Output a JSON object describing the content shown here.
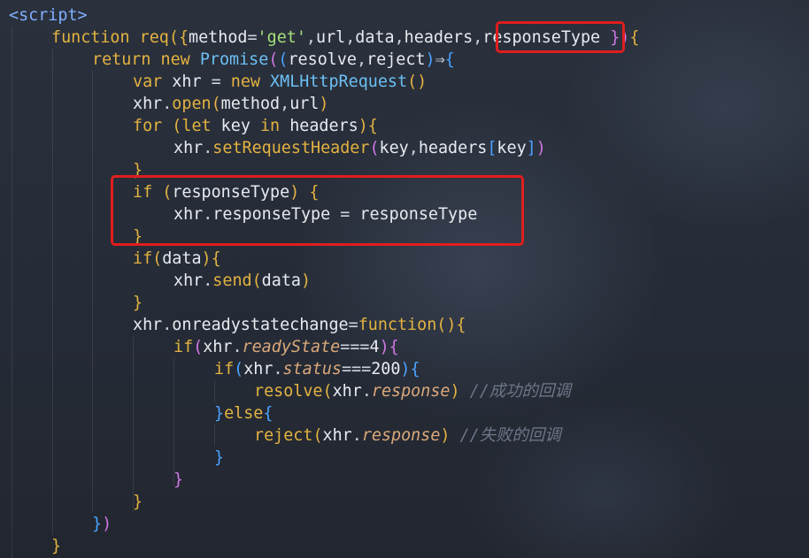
{
  "code": {
    "language": "html/javascript",
    "lines": [
      "<script>",
      "function req({method='get',url,data,headers,responseType }){",
      "return new Promise((resolve,reject)⇒{",
      "var xhr = new XMLHttpRequest()",
      "xhr.open(method,url)",
      "for (let key in headers){",
      "xhr.setRequestHeader(key,headers[key])",
      "}",
      "if (responseType) {",
      "xhr.responseType = responseType",
      "}",
      "if(data){",
      "xhr.send(data)",
      "}",
      "xhr.onreadystatechange=function(){",
      "if(xhr.readyState===4){",
      "if(xhr.status===200){",
      "resolve(xhr.response) //成功的回调",
      "}else{",
      "reject(xhr.response) //失败的回调",
      "}",
      "}",
      "}",
      "})",
      "}"
    ]
  },
  "tokens": {
    "l0": {
      "lt": "<",
      "tag": "script",
      "gt": ">"
    },
    "l1": {
      "kw": "function",
      "name": "req",
      "p1": "({",
      "a": "method",
      "eq": "=",
      "s": "'get'",
      "c1": ",",
      "b": "url",
      "c2": ",",
      "c": "data",
      "c3": ",",
      "d": "headers",
      "c4": ",",
      "e": "responseType",
      "sp": " ",
      "close": "})",
      "brace": "{"
    },
    "l2": {
      "kw1": "return",
      "kw2": "new",
      "cls": "Promise",
      "o1": "(",
      "o2": "(",
      "a": "resolve",
      "c": ",",
      "b": "reject",
      "o3": ")",
      "arrow": "⇒",
      "brace": "{"
    },
    "l3": {
      "kw1": "var",
      "id": "xhr",
      "eq": "=",
      "kw2": "new",
      "cls": "XMLHttpRequest",
      "p": "()"
    },
    "l4": {
      "o": "xhr",
      "dot": ".",
      "m": "open",
      "p1": "(",
      "a": "method",
      "c": ",",
      "b": "url",
      "p2": ")"
    },
    "l5": {
      "kw": "for",
      "p1": "(",
      "kw2": "let",
      "a": "key",
      "kw3": "in",
      "b": "headers",
      "p2": ")",
      "brace": "{"
    },
    "l6": {
      "o": "xhr",
      "dot": ".",
      "m": "setRequestHeader",
      "p1": "(",
      "a": "key",
      "c": ",",
      "b": "headers",
      "bk1": "[",
      "k": "key",
      "bk2": "]",
      "p2": ")"
    },
    "l7": {
      "brace": "}"
    },
    "l8": {
      "kw": "if",
      "p1": "(",
      "a": "responseType",
      "p2": ")",
      "brace": "{"
    },
    "l9": {
      "o": "xhr",
      "dot": ".",
      "prop": "responseType",
      "eq": "=",
      "v": "responseType"
    },
    "l10": {
      "brace": "}"
    },
    "l11": {
      "kw": "if",
      "p1": "(",
      "a": "data",
      "p2": ")",
      "brace": "{"
    },
    "l12": {
      "o": "xhr",
      "dot": ".",
      "m": "send",
      "p1": "(",
      "a": "data",
      "p2": ")"
    },
    "l13": {
      "brace": "}"
    },
    "l14": {
      "o": "xhr",
      "dot": ".",
      "prop": "onreadystatechange",
      "eq": "=",
      "kw": "function",
      "p": "()",
      "brace": "{"
    },
    "l15": {
      "kw": "if",
      "p1": "(",
      "o": "xhr",
      "dot": ".",
      "prop": "readyState",
      "op": "===",
      "n": "4",
      "p2": ")",
      "brace": "{"
    },
    "l16": {
      "kw": "if",
      "p1": "(",
      "o": "xhr",
      "dot": ".",
      "prop": "status",
      "op": "===",
      "n": "200",
      "p2": ")",
      "brace": "{"
    },
    "l17": {
      "fn": "resolve",
      "p1": "(",
      "o": "xhr",
      "dot": ".",
      "prop": "response",
      "p2": ")",
      "cm": "//成功的回调"
    },
    "l18": {
      "b1": "}",
      "kw": "else",
      "b2": "{"
    },
    "l19": {
      "fn": "reject",
      "p1": "(",
      "o": "xhr",
      "dot": ".",
      "prop": "response",
      "p2": ")",
      "cm": "//失败的回调"
    },
    "l20": {
      "brace": "}"
    },
    "l21": {
      "brace": "}"
    },
    "l22": {
      "brace": "}"
    },
    "l23": {
      "b": "}",
      "p": ")"
    },
    "l24": {
      "brace": "}"
    }
  },
  "colors": {
    "highlight_box": "#e01e1e",
    "background": "#252a35",
    "keyword": "#e3b341",
    "string": "#a5e07a",
    "class": "#6cc0f5",
    "comment": "#6d7688"
  }
}
